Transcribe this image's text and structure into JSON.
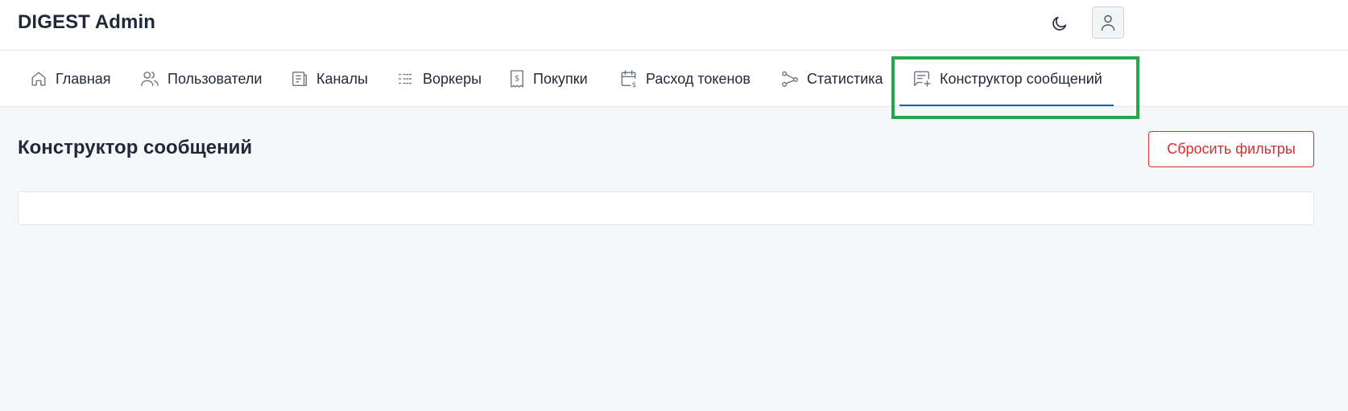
{
  "header": {
    "brand": "DIGEST Admin",
    "theme_toggle_icon": "moon-icon",
    "user_icon": "user-icon"
  },
  "nav": {
    "items": [
      {
        "label": "Главная",
        "icon": "home-icon"
      },
      {
        "label": "Пользователи",
        "icon": "users-icon"
      },
      {
        "label": "Каналы",
        "icon": "channels-icon"
      },
      {
        "label": "Воркеры",
        "icon": "list-icon"
      },
      {
        "label": "Покупки",
        "icon": "receipt-icon"
      },
      {
        "label": "Расход токенов",
        "icon": "calendar-dollar-icon"
      },
      {
        "label": "Статистика",
        "icon": "share-graph-icon"
      },
      {
        "label": "Конструктор сообщений",
        "icon": "message-plus-icon",
        "active": true
      }
    ]
  },
  "main": {
    "title": "Конструктор сообщений",
    "reset_label": "Сбросить фильтры"
  },
  "colors": {
    "accent": "#1565c0",
    "danger": "#d32f2f",
    "highlight": "#22a846",
    "background": "#f6f7fb"
  }
}
